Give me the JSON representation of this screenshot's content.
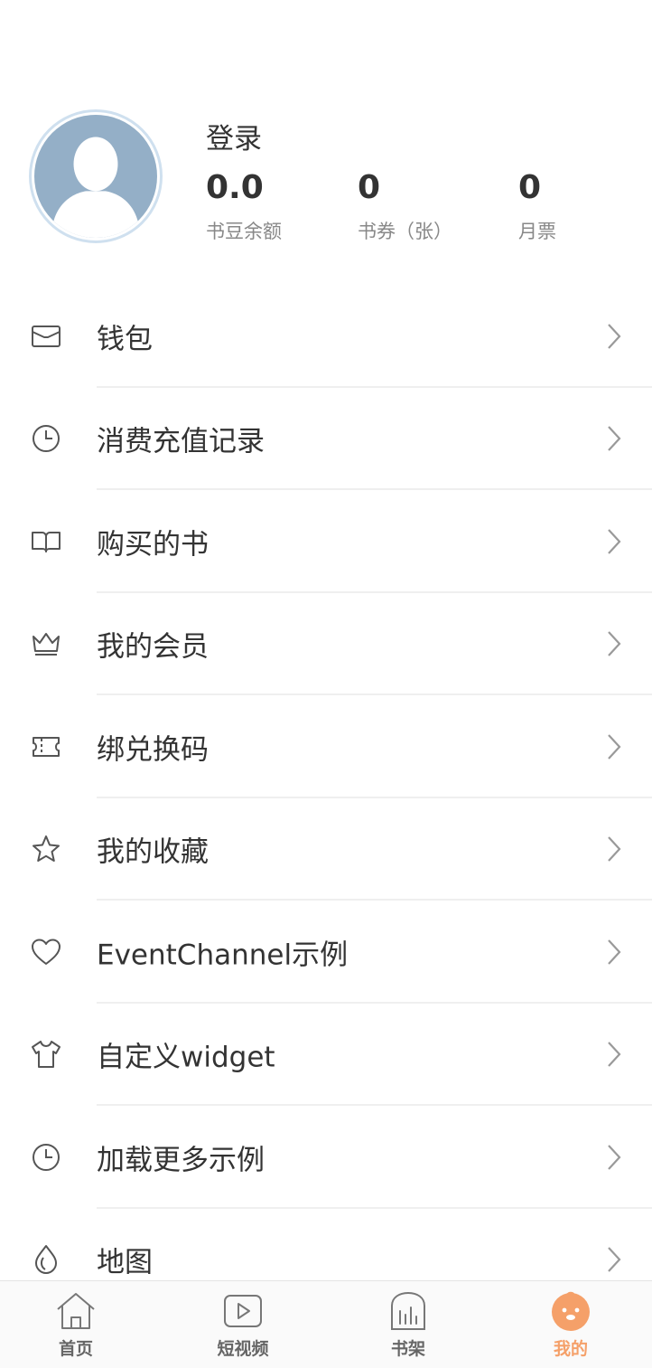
{
  "profile": {
    "login_label": "登录",
    "stats": [
      {
        "value": "0.0",
        "label": "书豆余额"
      },
      {
        "value": "0",
        "label": "书券（张）"
      },
      {
        "value": "0",
        "label": "月票"
      }
    ]
  },
  "menu": {
    "items": [
      {
        "label": "钱包",
        "icon": "wallet-icon"
      },
      {
        "label": "消费充值记录",
        "icon": "clock-icon"
      },
      {
        "label": "购买的书",
        "icon": "book-icon"
      },
      {
        "label": "我的会员",
        "icon": "crown-icon"
      },
      {
        "label": "绑兑换码",
        "icon": "ticket-icon"
      },
      {
        "label": "我的收藏",
        "icon": "star-icon"
      },
      {
        "label": "EventChannel示例",
        "icon": "heart-icon"
      },
      {
        "label": "自定义widget",
        "icon": "tshirt-icon"
      },
      {
        "label": "加载更多示例",
        "icon": "clock-icon"
      },
      {
        "label": "地图",
        "icon": "location-icon"
      }
    ]
  },
  "tabbar": {
    "tabs": [
      {
        "label": "首页",
        "icon": "home-icon"
      },
      {
        "label": "短视频",
        "icon": "video-icon"
      },
      {
        "label": "书架",
        "icon": "bookshelf-icon"
      },
      {
        "label": "我的",
        "icon": "mine-icon",
        "active": true
      }
    ],
    "active_color": "#f5a069"
  }
}
